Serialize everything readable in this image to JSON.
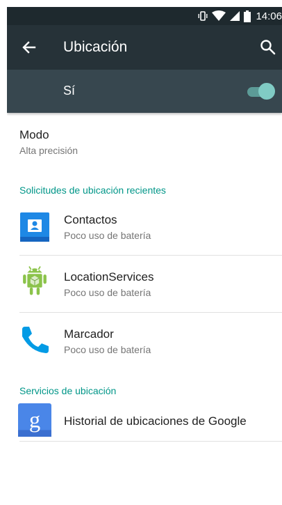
{
  "status_bar": {
    "time": "14:06",
    "icons": [
      "vibrate-icon",
      "wifi-icon",
      "signal-icon",
      "battery-icon"
    ]
  },
  "app_bar": {
    "title": "Ubicación",
    "back_icon": "arrow-back-icon",
    "search_icon": "search-icon"
  },
  "master_toggle": {
    "label": "Sí",
    "state": "on",
    "accent_color": "#80cbc4"
  },
  "mode": {
    "title": "Modo",
    "value": "Alta precisión"
  },
  "recent_requests": {
    "header": "Solicitudes de ubicación recientes",
    "items": [
      {
        "name": "Contactos",
        "detail": "Poco uso de batería",
        "icon": "contacts-icon"
      },
      {
        "name": "LocationServices",
        "detail": "Poco uso de batería",
        "icon": "android-icon"
      },
      {
        "name": "Marcador",
        "detail": "Poco uso de batería",
        "icon": "phone-icon"
      }
    ]
  },
  "location_services": {
    "header": "Servicios de ubicación",
    "items": [
      {
        "name": "Historial de ubicaciones de Google",
        "icon": "google-icon"
      }
    ]
  },
  "colors": {
    "status_bar": "#1e292e",
    "app_bar": "#263238",
    "toggle_bar": "#37474f",
    "section_header": "#009688"
  }
}
